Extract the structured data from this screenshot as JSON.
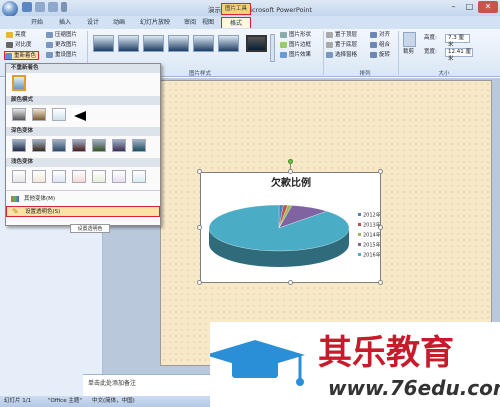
{
  "window": {
    "title": "演示文稿1 - Microsoft PowerPoint",
    "tool_header": "图片工具"
  },
  "tabs": [
    {
      "label": "开始"
    },
    {
      "label": "插入"
    },
    {
      "label": "设计"
    },
    {
      "label": "动画"
    },
    {
      "label": "幻灯片放映"
    },
    {
      "label": "审阅"
    },
    {
      "label": "视图"
    },
    {
      "label": "格式"
    }
  ],
  "ribbon": {
    "adjust": {
      "brightness": "亮度",
      "contrast": "对比度",
      "recolor": "重新着色",
      "compress": "压缩图片",
      "change": "更改图片",
      "reset": "重设图片"
    },
    "styles_group": "图片样式",
    "style_options": {
      "shape": "图片形状",
      "border": "图片边框",
      "effects": "图片效果"
    },
    "arrange": {
      "front": "置于顶层",
      "back": "置于底层",
      "pane": "选择窗格",
      "align": "对齐",
      "group": "组合",
      "rotate": "旋转",
      "label": "排列"
    },
    "size": {
      "crop": "裁剪",
      "height_label": "高度:",
      "height_value": "7.3 厘米",
      "width_label": "宽度:",
      "width_value": "12.41 厘米",
      "label": "大小"
    }
  },
  "dropdown": {
    "no_recolor_header": "不重新着色",
    "color_modes": "颜色模式",
    "dark_variants": "深色变体",
    "light_variants": "浅色变体",
    "more_variants": "其他变体(M)",
    "set_transparent": "设置透明色(S)",
    "tooltip": "设置透明色"
  },
  "chart_data": {
    "type": "pie",
    "title": "欠款比例",
    "categories": [
      "2012年",
      "2013年",
      "2014年",
      "2015年",
      "2016年"
    ],
    "values": [
      1,
      1,
      1,
      9,
      88
    ],
    "colors": [
      "#4f81bd",
      "#c0504d",
      "#9bbb59",
      "#8064a2",
      "#4bacc6"
    ],
    "legend": "right"
  },
  "notes": {
    "placeholder": "单击此处添加备注"
  },
  "status": {
    "slide": "幻灯片 1/1",
    "theme": "\"Office 主题\"",
    "lang": "中文(简体，中国)"
  },
  "watermark": {
    "text": "其乐教育",
    "url": "www.76edu.com"
  }
}
